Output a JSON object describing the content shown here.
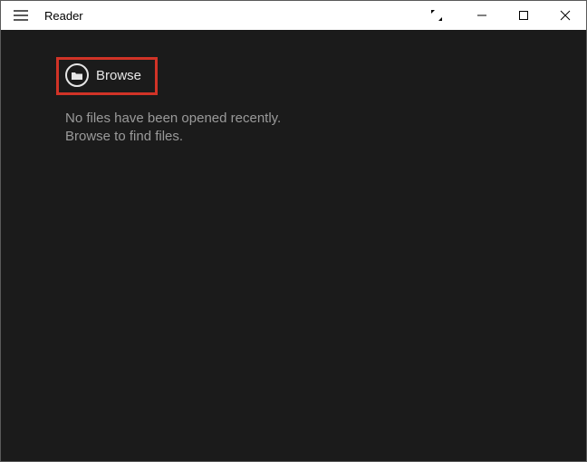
{
  "titlebar": {
    "app_title": "Reader"
  },
  "content": {
    "browse_label": "Browse",
    "empty_line1": "No files have been opened recently.",
    "empty_line2": "Browse to find files."
  },
  "highlight": {
    "color": "#d13327"
  }
}
